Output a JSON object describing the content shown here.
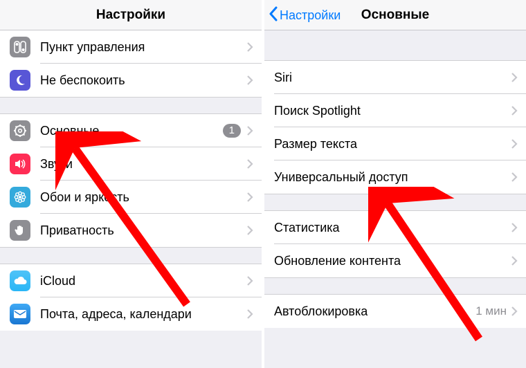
{
  "left": {
    "title": "Настройки",
    "groups": [
      [
        {
          "icon": "control-center",
          "label": "Пункт управления"
        },
        {
          "icon": "dnd",
          "label": "Не беспокоить"
        }
      ],
      [
        {
          "icon": "general",
          "label": "Основные",
          "badge": "1"
        },
        {
          "icon": "sounds",
          "label": "Звуки"
        },
        {
          "icon": "wallpaper",
          "label": "Обои и яркость"
        },
        {
          "icon": "privacy",
          "label": "Приватность"
        }
      ],
      [
        {
          "icon": "icloud",
          "label": "iCloud"
        },
        {
          "icon": "mail",
          "label": "Почта, адреса, календари"
        }
      ]
    ]
  },
  "right": {
    "back": "Настройки",
    "title": "Основные",
    "groups": [
      [
        {
          "label": "Siri"
        },
        {
          "label": "Поиск Spotlight"
        },
        {
          "label": "Размер текста"
        },
        {
          "label": "Универсальный доступ"
        }
      ],
      [
        {
          "label": "Статистика"
        },
        {
          "label": "Обновление контента"
        }
      ],
      [
        {
          "label": "Автоблокировка",
          "value": "1 мин"
        }
      ]
    ]
  }
}
